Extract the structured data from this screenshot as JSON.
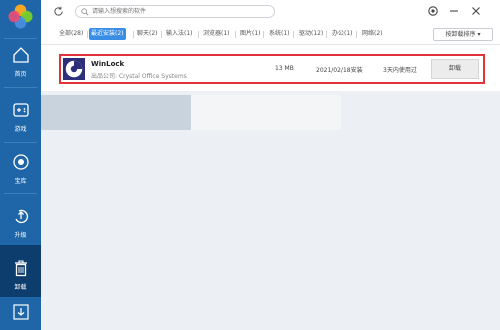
{
  "search": {
    "placeholder": "请输入想搜索的软件"
  },
  "sidebar": {
    "items": [
      {
        "label": "首页",
        "icon": "home-icon"
      },
      {
        "label": "游戏",
        "icon": "gamepad-icon"
      },
      {
        "label": "宝库",
        "icon": "treasure-icon"
      },
      {
        "label": "升级",
        "icon": "upgrade-icon"
      },
      {
        "label": "卸载",
        "icon": "trash-icon"
      },
      {
        "label": "",
        "icon": "download-icon"
      }
    ]
  },
  "tabs": [
    {
      "label": "全部(28)"
    },
    {
      "label": "最近安装(2)",
      "active": true
    },
    {
      "label": "聊天(2)"
    },
    {
      "label": "输入法(1)"
    },
    {
      "label": "浏览器(1)"
    },
    {
      "label": "图片(1)"
    },
    {
      "label": "系统(1)"
    },
    {
      "label": "驱动(12)"
    },
    {
      "label": "办公(1)"
    },
    {
      "label": "网络(2)"
    }
  ],
  "sort": {
    "label": "按卸载排序"
  },
  "software": [
    {
      "name": "WinLock",
      "publisher": "出品公司: Crystal Office Systems",
      "size": "13 MB",
      "install_date": "2021/02/18安装",
      "usage": "3天内使用过",
      "action_label": "卸载"
    }
  ],
  "colors": {
    "sidebar": "#1e66a8",
    "sidebar_active": "#0d3d6c",
    "accent": "#3a8de4",
    "highlight_border": "#e2333a"
  }
}
